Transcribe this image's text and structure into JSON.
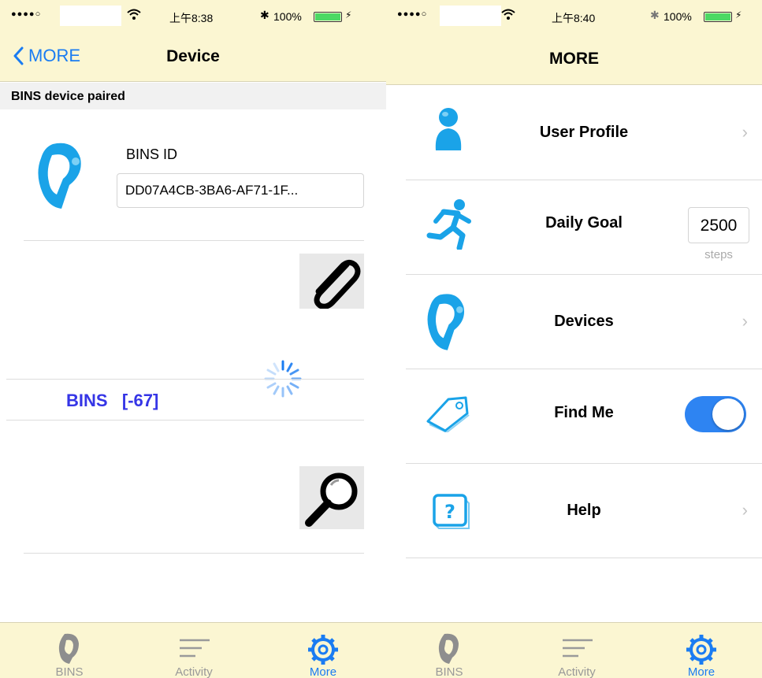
{
  "left_screen": {
    "statusbar": {
      "signal": "●●●●○",
      "time": "上午8:38",
      "battery_pct": "100%"
    },
    "navbar": {
      "back_label": "MORE",
      "title": "Device"
    },
    "section_header": "BINS device paired",
    "bins_id_label": "BINS ID",
    "bins_id_value": "DD07A4CB-3BA6-AF71-1F...",
    "rssi_name": "BINS",
    "rssi_value": "[-67]",
    "tabs": [
      {
        "label": "BINS",
        "icon": "band-icon",
        "active": false
      },
      {
        "label": "Activity",
        "icon": "activity-lines-icon",
        "active": false
      },
      {
        "label": "More",
        "icon": "gear-icon",
        "active": true
      }
    ]
  },
  "right_screen": {
    "statusbar": {
      "signal": "●●●●○",
      "time": "上午8:40",
      "battery_pct": "100%"
    },
    "navbar": {
      "title": "MORE"
    },
    "rows": [
      {
        "label": "User Profile",
        "icon": "user-icon",
        "accessory": "chevron"
      },
      {
        "label": "Daily Goal",
        "icon": "running-man-icon",
        "accessory": "field",
        "value": "2500",
        "unit": "steps"
      },
      {
        "label": "Devices",
        "icon": "band-icon",
        "accessory": "chevron"
      },
      {
        "label": "Find Me",
        "icon": "tag-icon",
        "accessory": "toggle",
        "toggle_on": true
      },
      {
        "label": "Help",
        "icon": "help-icon",
        "accessory": "chevron"
      }
    ],
    "tabs": [
      {
        "label": "BINS",
        "icon": "band-icon",
        "active": false
      },
      {
        "label": "Activity",
        "icon": "activity-lines-icon",
        "active": false
      },
      {
        "label": "More",
        "icon": "gear-icon",
        "active": true
      }
    ]
  },
  "colors": {
    "bar_bg": "#fbf6d2",
    "accent": "#1a7cf2",
    "rssi": "#3535e6",
    "toggle_on": "#2e84f2",
    "icon_blue": "#1aa3e8"
  }
}
